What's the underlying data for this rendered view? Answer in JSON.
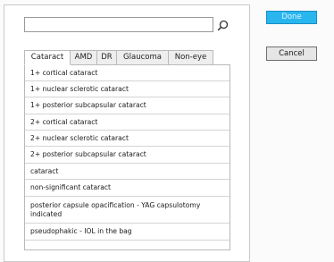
{
  "search": {
    "value": "",
    "placeholder": ""
  },
  "tabs": [
    {
      "label": "Cataract",
      "active": true
    },
    {
      "label": "AMD",
      "active": false
    },
    {
      "label": "DR",
      "active": false
    },
    {
      "label": "Glaucoma",
      "active": false
    },
    {
      "label": "Non-eye",
      "active": false
    }
  ],
  "list": [
    "1+ cortical cataract",
    "1+ nuclear sclerotic cataract",
    "1+ posterior subcapsular cataract",
    "2+ cortical cataract",
    "2+ nuclear sclerotic cataract",
    "2+ posterior subcapsular cataract",
    "cataract",
    "non-significant cataract",
    "posterior capsule opacification - YAG capsulotomy indicated",
    "pseudophakic - IOL in the bag"
  ],
  "buttons": {
    "done": "Done",
    "cancel": "Cancel"
  },
  "colors": {
    "done_bg": "#29b6ef",
    "cancel_bg": "#e6e6e6"
  }
}
